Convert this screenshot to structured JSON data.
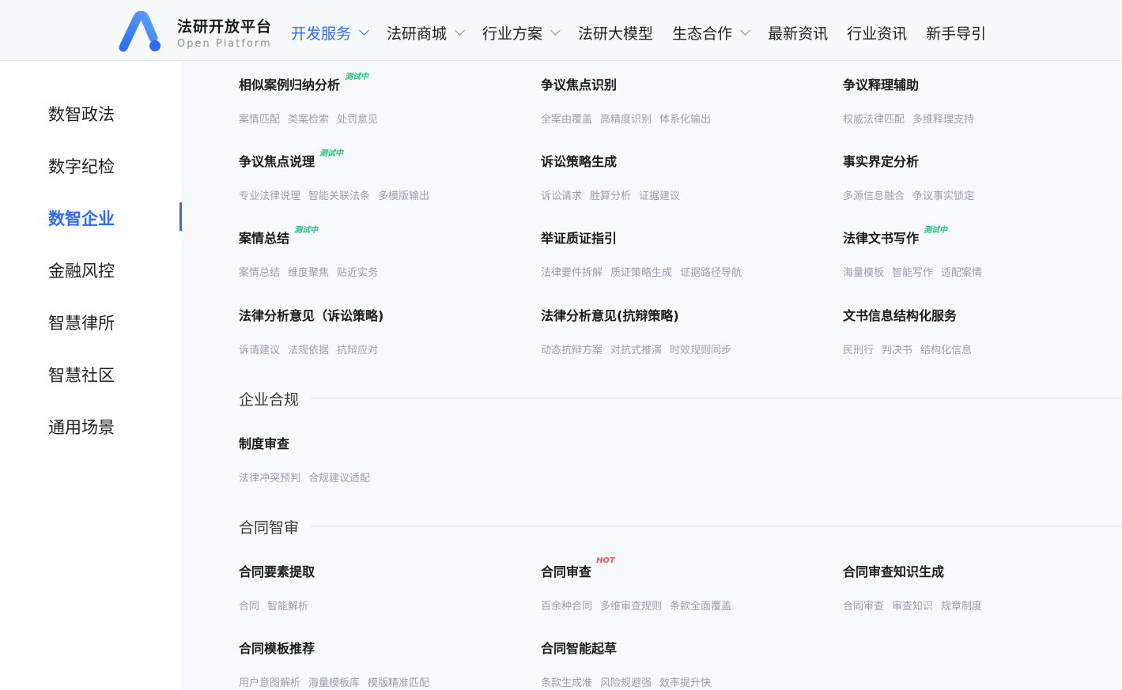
{
  "header": {
    "brand_title": "法研开放平台",
    "brand_sub": "Open  Platform",
    "nav": [
      {
        "label": "开发服务",
        "dropdown": true,
        "active": true
      },
      {
        "label": "法研商城",
        "dropdown": true
      },
      {
        "label": "行业方案",
        "dropdown": true
      },
      {
        "label": "法研大模型",
        "dropdown": false
      },
      {
        "label": "生态合作",
        "dropdown": true
      },
      {
        "label": "最新资讯",
        "dropdown": false
      },
      {
        "label": "行业资讯",
        "dropdown": false
      },
      {
        "label": "新手导引",
        "dropdown": false
      }
    ]
  },
  "sidebar": {
    "items": [
      {
        "label": "数智政法"
      },
      {
        "label": "数字纪检"
      },
      {
        "label": "数智企业",
        "active": true
      },
      {
        "label": "金融风控"
      },
      {
        "label": "智慧律所"
      },
      {
        "label": "智慧社区"
      },
      {
        "label": "通用场景"
      }
    ]
  },
  "colors": {
    "accent": "#2f6bff",
    "test_badge": "#27c37a",
    "hot_badge": "#ff4d4f"
  },
  "cards": [
    {
      "title": "相似案例归纳分析",
      "badge": "测试中",
      "tags": [
        "案情匹配",
        "类案检索",
        "处罚意见"
      ]
    },
    {
      "title": "争议焦点识别",
      "badge": "",
      "tags": [
        "全案由覆盖",
        "高精度识别",
        "体系化输出"
      ]
    },
    {
      "title": "争议释理辅助",
      "badge": "",
      "tags": [
        "权威法律匹配",
        "多维释理支持"
      ]
    },
    {
      "title": "争议焦点说理",
      "badge": "测试中",
      "tags": [
        "专业法律说理",
        "智能关联法条",
        "多模版输出"
      ]
    },
    {
      "title": "诉讼策略生成",
      "badge": "",
      "tags": [
        "诉讼请求",
        "胜算分析",
        "证据建议"
      ]
    },
    {
      "title": "事实界定分析",
      "badge": "",
      "tags": [
        "多源信息融合",
        "争议事实锁定"
      ]
    },
    {
      "title": "案情总结",
      "badge": "测试中",
      "tags": [
        "案情总结",
        "维度聚焦",
        "贴近实务"
      ]
    },
    {
      "title": "举证质证指引",
      "badge": "",
      "tags": [
        "法律要件拆解",
        "质证策略生成",
        "证据路径导航"
      ]
    },
    {
      "title": "法律文书写作",
      "badge": "测试中",
      "tags": [
        "海量模板",
        "智能写作",
        "适配案情"
      ]
    },
    {
      "title": "法律分析意见（诉讼策略)",
      "badge": "",
      "tags": [
        "诉请建议",
        "法规依据",
        "抗辩应对"
      ]
    },
    {
      "title": "法律分析意见(抗辩策略)",
      "badge": "",
      "tags": [
        "动态抗辩方案",
        "对抗式推演",
        "时效规则同步"
      ]
    },
    {
      "title": "文书信息结构化服务",
      "badge": "",
      "tags": [
        "民刑行",
        "判决书",
        "结构化信息"
      ]
    }
  ],
  "sections": [
    {
      "title": "企业合规",
      "cards": [
        {
          "title": "制度审查",
          "badge": "",
          "tags": [
            "法律冲突预判",
            "合规建议适配"
          ]
        }
      ]
    },
    {
      "title": "合同智审",
      "cards": [
        {
          "title": "合同要素提取",
          "badge": "",
          "tags": [
            "合同",
            "智能解析"
          ]
        },
        {
          "title": "合同审查",
          "badge": "HOT",
          "tags": [
            "百余种合同",
            "多维审查规则",
            "条款全面覆盖"
          ]
        },
        {
          "title": "合同审查知识生成",
          "badge": "",
          "tags": [
            "合同审查",
            "审查知识",
            "规章制度"
          ]
        },
        {
          "title": "合同模板推荐",
          "badge": "",
          "tags": [
            "用户意图解析",
            "海量模板库",
            "模版精准匹配"
          ]
        },
        {
          "title": "合同智能起草",
          "badge": "",
          "tags": [
            "条款生成准",
            "风险规避强",
            "效率提升快"
          ]
        }
      ]
    }
  ]
}
